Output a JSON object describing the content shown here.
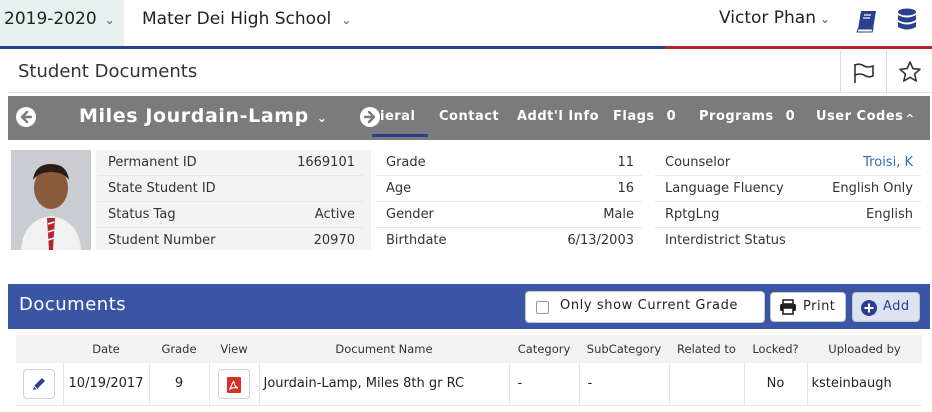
{
  "topbar": {
    "year": "2019-2020",
    "school": "Mater Dei High School",
    "user": "Victor Phan",
    "icons": {
      "book": "book-icon",
      "database": "database-icon"
    },
    "colors": {
      "year_bg": "#e6f0ef",
      "stripe_blue": "#2a3f8f",
      "stripe_red": "#b3262e"
    }
  },
  "page": {
    "title": "Student Documents",
    "icons": {
      "flag": "flag-icon",
      "star": "star-icon"
    }
  },
  "student_bar": {
    "name": "Miles Jourdain-Lamp",
    "tabs": [
      {
        "label": "ieral",
        "count": ""
      },
      {
        "label": "Contact",
        "count": ""
      },
      {
        "label": "Addt'l Info",
        "count": ""
      },
      {
        "label": "Flags",
        "count": "0"
      },
      {
        "label": "Programs",
        "count": "0"
      },
      {
        "label": "User Codes",
        "count": ""
      }
    ],
    "bg_color": "#7b7b7b"
  },
  "student_info": {
    "left": [
      {
        "label": "Permanent ID",
        "value": "1669101"
      },
      {
        "label": "State Student ID",
        "value": ""
      },
      {
        "label": "Status Tag",
        "value": "Active"
      },
      {
        "label": "Student Number",
        "value": "20970"
      }
    ],
    "middle": [
      {
        "label": "Grade",
        "value": "11"
      },
      {
        "label": "Age",
        "value": "16"
      },
      {
        "label": "Gender",
        "value": "Male"
      },
      {
        "label": "Birthdate",
        "value": "6/13/2003"
      }
    ],
    "right": [
      {
        "label": "Counselor",
        "value": "Troisi, K"
      },
      {
        "label": "Language Fluency",
        "value": "English Only"
      },
      {
        "label": "RptgLng",
        "value": "English"
      },
      {
        "label": "Interdistrict Status",
        "value": ""
      }
    ]
  },
  "documents": {
    "title": "Documents",
    "current_grade_label": "Only show Current Grade",
    "current_grade_checked": false,
    "print_label": "Print",
    "add_label": "Add",
    "bar_color": "#3a55a4",
    "columns": [
      "",
      "Date",
      "Grade",
      "View",
      "Document Name",
      "Category",
      "SubCategory",
      "Related to",
      "Locked?",
      "Uploaded by"
    ],
    "rows": [
      {
        "date": "10/19/2017",
        "grade": "9",
        "document_name": "Jourdain-Lamp, Miles 8th gr RC",
        "category": "-",
        "subcategory": "-",
        "related_to": "",
        "locked": "No",
        "uploaded_by": "ksteinbaugh"
      }
    ]
  }
}
